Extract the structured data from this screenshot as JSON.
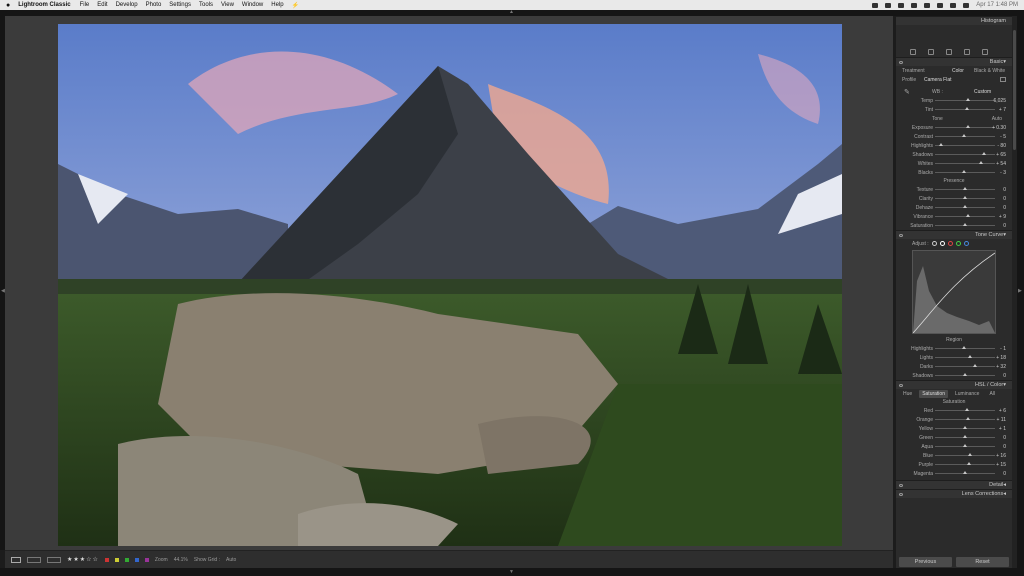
{
  "menubar": {
    "app": "Lightroom Classic",
    "items": [
      "File",
      "Edit",
      "Develop",
      "Photo",
      "Settings",
      "Tools",
      "View",
      "Window",
      "Help"
    ],
    "clock": "Apr 17 1:48 PM"
  },
  "panel": {
    "histogram": "Histogram",
    "basic": {
      "title": "Basic",
      "treatment_label": "Treatment",
      "treatment_color": "Color",
      "treatment_bw": "Black & White",
      "profile_label": "Profile",
      "profile_value": "Camera Flat",
      "wb_label": "WB :",
      "wb_value": "Custom",
      "wb_sliders": [
        {
          "label": "Temp",
          "value": "6,025",
          "pos": 0.55
        },
        {
          "label": "Tint",
          "value": "+ 7",
          "pos": 0.53
        }
      ],
      "tone_label": "Tone",
      "tone_auto": "Auto",
      "tone_sliders": [
        {
          "label": "Exposure",
          "value": "+ 0.30",
          "pos": 0.55
        },
        {
          "label": "Contrast",
          "value": "- 5",
          "pos": 0.48
        },
        {
          "label": "Highlights",
          "value": "- 80",
          "pos": 0.1
        },
        {
          "label": "Shadows",
          "value": "+ 65",
          "pos": 0.82
        },
        {
          "label": "Whites",
          "value": "+ 54",
          "pos": 0.77
        },
        {
          "label": "Blacks",
          "value": "- 3",
          "pos": 0.48
        }
      ],
      "presence_label": "Presence",
      "presence_sliders": [
        {
          "label": "Texture",
          "value": "0",
          "pos": 0.5
        },
        {
          "label": "Clarity",
          "value": "0",
          "pos": 0.5
        },
        {
          "label": "Dehaze",
          "value": "0",
          "pos": 0.5
        },
        {
          "label": "Vibrance",
          "value": "+ 9",
          "pos": 0.55
        },
        {
          "label": "Saturation",
          "value": "0",
          "pos": 0.5
        }
      ]
    },
    "tonecurve": {
      "title": "Tone Curve",
      "adjust": "Adjust :",
      "region": "Region",
      "sliders": [
        {
          "label": "Highlights",
          "value": "- 1",
          "pos": 0.49
        },
        {
          "label": "Lights",
          "value": "+ 18",
          "pos": 0.59
        },
        {
          "label": "Darks",
          "value": "+ 32",
          "pos": 0.66
        },
        {
          "label": "Shadows",
          "value": "0",
          "pos": 0.5
        }
      ]
    },
    "hsl": {
      "title": "HSL / Color",
      "tabs": [
        "Hue",
        "Saturation",
        "Luminance",
        "All"
      ],
      "saturation_label": "Saturation",
      "sliders": [
        {
          "label": "Red",
          "value": "+ 6",
          "pos": 0.53
        },
        {
          "label": "Orange",
          "value": "+ 11",
          "pos": 0.55
        },
        {
          "label": "Yellow",
          "value": "+ 1",
          "pos": 0.5
        },
        {
          "label": "Green",
          "value": "0",
          "pos": 0.5
        },
        {
          "label": "Aqua",
          "value": "0",
          "pos": 0.5
        },
        {
          "label": "Blue",
          "value": "+ 16",
          "pos": 0.58
        },
        {
          "label": "Purple",
          "value": "+ 15",
          "pos": 0.57
        },
        {
          "label": "Magenta",
          "value": "0",
          "pos": 0.5
        }
      ]
    },
    "detail": "Detail",
    "lens": "Lens Corrections",
    "previous": "Previous",
    "reset": "Reset"
  },
  "toolbar": {
    "zoom_label": "Zoom",
    "zoom_value": "44.1%",
    "show_grid": "Show Grid :",
    "grid_value": "Auto",
    "stars": "★★★☆☆"
  }
}
